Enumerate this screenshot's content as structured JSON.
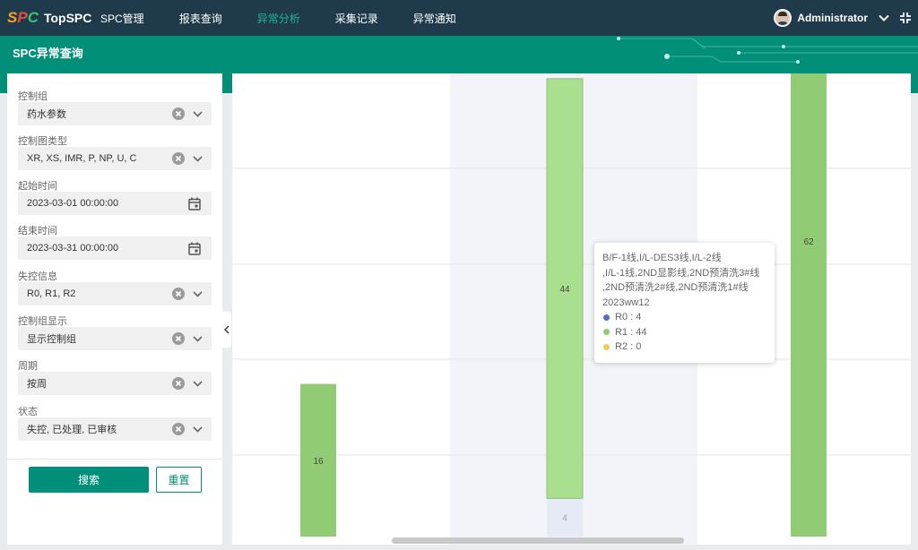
{
  "app": {
    "logo_mark": "SPC",
    "logo_text": "TopSPC"
  },
  "nav": [
    {
      "label": "SPC管理",
      "active": false
    },
    {
      "label": "报表查询",
      "active": false
    },
    {
      "label": "异常分析",
      "active": true
    },
    {
      "label": "采集记录",
      "active": false
    },
    {
      "label": "异常通知",
      "active": false
    }
  ],
  "user": {
    "name": "Administrator"
  },
  "page": {
    "title": "SPC异常查询"
  },
  "filters": [
    {
      "label": "控制组",
      "value": "药水参数",
      "control": "select"
    },
    {
      "label": "控制图类型",
      "value": "XR, XS, IMR, P, NP, U, C",
      "control": "select"
    },
    {
      "label": "起始时间",
      "value": "2023-03-01 00:00:00",
      "control": "date"
    },
    {
      "label": "结束时间",
      "value": "2023-03-31 00:00:00",
      "control": "date"
    },
    {
      "label": "失控信息",
      "value": "R0, R1, R2",
      "control": "select"
    },
    {
      "label": "控制组显示",
      "value": "显示控制组",
      "control": "select"
    },
    {
      "label": "周期",
      "value": "按周",
      "control": "select"
    },
    {
      "label": "状态",
      "value": "失控, 已处理, 已审核",
      "control": "select"
    }
  ],
  "buttons": {
    "search": "搜索",
    "reset": "重置"
  },
  "colors": {
    "primary": "#018f79",
    "navbar": "#1f3b4b",
    "r0": "#5470c6",
    "r1": "#91cc75",
    "r1_hover": "#a9df8f",
    "r2": "#fac858"
  },
  "chart_data": {
    "type": "bar",
    "stacked": true,
    "categories": [
      "",
      "2023ww12",
      ""
    ],
    "series": [
      {
        "name": "R0",
        "values": [
          0,
          4,
          0
        ]
      },
      {
        "name": "R1",
        "values": [
          16,
          44,
          62
        ]
      },
      {
        "name": "R2",
        "values": [
          0,
          0,
          0
        ]
      }
    ],
    "ylim": [
      0,
      49
    ],
    "grid": true,
    "highlighted_category": 1
  },
  "tooltip": {
    "title_lines": [
      "B/F-1线,I/L-DES3线,I/L-2线",
      ",I/L-1线,2ND显影线,2ND预清洗3#线",
      ",2ND预清洗2#线,2ND预清洗1#线",
      "2023ww12"
    ],
    "rows": [
      {
        "name": "R0",
        "value": "4",
        "color_key": "r0"
      },
      {
        "name": "R1",
        "value": "44",
        "color_key": "r1"
      },
      {
        "name": "R2",
        "value": "0",
        "color_key": "r2"
      }
    ]
  }
}
